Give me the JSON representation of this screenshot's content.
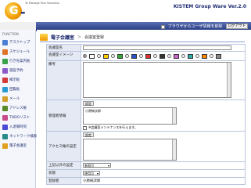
{
  "header": {
    "logo_tagline": "To Manage Your Business",
    "logo_letter": "G",
    "logo_word": "-BOARD",
    "version": "KISTEM Group Ware Ver.2.0"
  },
  "topbar": {
    "browser_sync_label": "ブラウザからユーザ情報を削除",
    "logout_label": "ログアウト"
  },
  "sidebar": {
    "title": "FUNCTION",
    "items": [
      {
        "label": "デスクトップ",
        "icon": "desktop-icon",
        "color": "#4a7fd4"
      },
      {
        "label": "スケジュール",
        "icon": "schedule-icon",
        "color": "#e0742a"
      },
      {
        "label": "行き先案内板",
        "icon": "destination-board-icon",
        "color": "#3aa04a"
      },
      {
        "label": "施設予約",
        "icon": "facility-icon",
        "color": "#8b5ac8"
      },
      {
        "label": "掲示板",
        "icon": "bulletin-icon",
        "color": "#d43a3a"
      },
      {
        "label": "回覧板",
        "icon": "circular-icon",
        "color": "#2a9ad4"
      },
      {
        "label": "メール",
        "icon": "mail-icon",
        "color": "#d4a02a"
      },
      {
        "label": "アドレス帳",
        "icon": "address-book-icon",
        "color": "#5a8a2a"
      },
      {
        "label": "TODOリスト",
        "icon": "todo-icon",
        "color": "#c84a8a"
      },
      {
        "label": "入退場時刻",
        "icon": "clock-icon",
        "color": "#4a4ad4"
      },
      {
        "label": "ネットワーク検索",
        "icon": "network-icon",
        "color": "#2a8a8a"
      },
      {
        "label": "電子会議室",
        "icon": "meeting-icon",
        "color": "#e0a020"
      }
    ]
  },
  "crumb": {
    "app": "電子会議室",
    "separator": "＞",
    "page": "会議室登録"
  },
  "form": {
    "name_label": "会議室名",
    "image_label": "会議室イメージ",
    "notes_label": "備考",
    "manager_label": "管理者情報",
    "manager_button": "設定",
    "manager_value": "小原純次郎",
    "maintenance_note": "※会議室メンテナンスを行えます。",
    "access_label": "アクセス権の設定",
    "access_button": "設定",
    "upper_limit_label": "上記以外の設定",
    "upper_limit_value": "参照可",
    "status_label": "状態",
    "status_value": "使用可",
    "registrant_label": "登録者",
    "registrant_value": "小原純次郎"
  },
  "image_options": [
    {
      "color": "#ffffff"
    },
    {
      "color": "#ffcc00"
    },
    {
      "color": "#33aa33"
    },
    {
      "color": "#2255cc"
    },
    {
      "color": "#dd3333"
    },
    {
      "color": "#333333"
    },
    {
      "color": "#cc66cc"
    },
    {
      "color": "#33aaaa"
    },
    {
      "color": "#ff8800"
    },
    {
      "color": "#888888"
    }
  ]
}
